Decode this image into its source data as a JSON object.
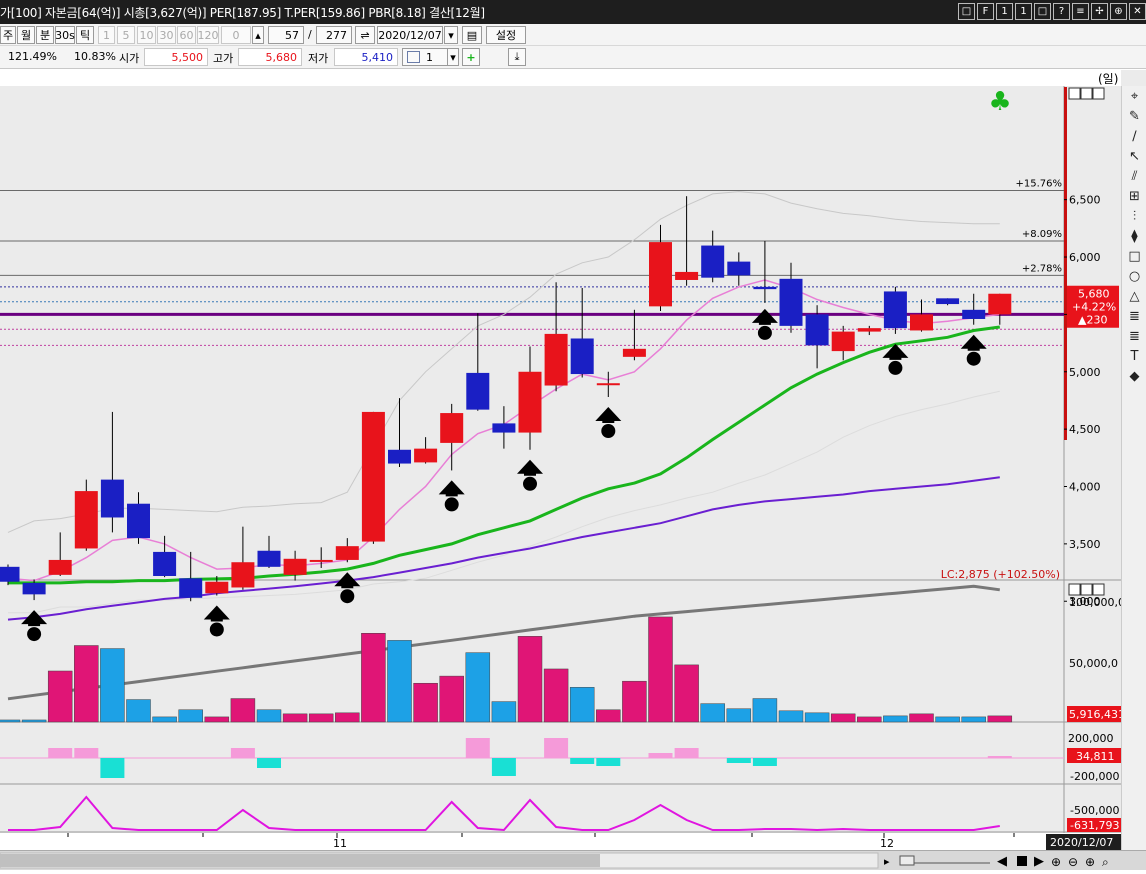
{
  "title": "가[100] 자본금[64(억)] 시총[3,627(억)] PER[187.95] T.PER[159.86] PBR[8.18] 결산[12월]",
  "window_buttons": [
    "□",
    "F",
    "1",
    "1",
    "□",
    "?",
    "≡",
    "✢",
    "⊕",
    "✕"
  ],
  "toolbar": {
    "period_buttons": [
      "주",
      "월",
      "분",
      "30s",
      "틱"
    ],
    "interval_buttons": [
      "1",
      "5",
      "10",
      "30",
      "60",
      "120"
    ],
    "interval_value": "0",
    "count_value": "57",
    "separator": "/",
    "total_value": "277",
    "date_value": "2020/12/07",
    "settings_label": "설정"
  },
  "quote": {
    "rate": "121.49%",
    "change_pct": "10.83%",
    "open_label": "시가",
    "open_value": "5,500",
    "high_label": "고가",
    "high_value": "5,680",
    "low_label": "저가",
    "low_value": "5,410",
    "spin_value": "1"
  },
  "chart_data": {
    "type": "candlestick",
    "unit_label": "(일)",
    "x_ticks": [
      "11",
      "12"
    ],
    "current_date": "2020/12/07",
    "price_ticks": [
      "6,500",
      "6,000",
      "5,500",
      "5,000",
      "4,500",
      "4,000",
      "3,500",
      "3,000"
    ],
    "candles": [
      {
        "o": 3300,
        "c": 3170,
        "h": 3320,
        "l": 3140
      },
      {
        "o": 3160,
        "c": 3060,
        "h": 3190,
        "l": 3010
      },
      {
        "o": 3230,
        "c": 3360,
        "h": 3600,
        "l": 3220
      },
      {
        "o": 3460,
        "c": 3960,
        "h": 4060,
        "l": 3440
      },
      {
        "o": 4060,
        "c": 3730,
        "h": 4650,
        "l": 3600
      },
      {
        "o": 3850,
        "c": 3550,
        "h": 3950,
        "l": 3500
      },
      {
        "o": 3430,
        "c": 3220,
        "h": 3570,
        "l": 3210
      },
      {
        "o": 3200,
        "c": 3030,
        "h": 3430,
        "l": 3000
      },
      {
        "o": 3070,
        "c": 3170,
        "h": 3220,
        "l": 3050
      },
      {
        "o": 3120,
        "c": 3340,
        "h": 3650,
        "l": 3100
      },
      {
        "o": 3440,
        "c": 3300,
        "h": 3570,
        "l": 3290
      },
      {
        "o": 3230,
        "c": 3370,
        "h": 3440,
        "l": 3180
      },
      {
        "o": 3360,
        "c": 3360,
        "h": 3470,
        "l": 3290
      },
      {
        "o": 3360,
        "c": 3480,
        "h": 3550,
        "l": 3340
      },
      {
        "o": 3520,
        "c": 4650,
        "h": 4650,
        "l": 3500
      },
      {
        "o": 4320,
        "c": 4200,
        "h": 4770,
        "l": 4170
      },
      {
        "o": 4210,
        "c": 4330,
        "h": 4430,
        "l": 4200
      },
      {
        "o": 4380,
        "c": 4640,
        "h": 4720,
        "l": 4140
      },
      {
        "o": 4990,
        "c": 4670,
        "h": 5510,
        "l": 4660
      },
      {
        "o": 4550,
        "c": 4470,
        "h": 4700,
        "l": 4330
      },
      {
        "o": 4470,
        "c": 5000,
        "h": 5220,
        "l": 4320
      },
      {
        "o": 4880,
        "c": 5330,
        "h": 5780,
        "l": 4830
      },
      {
        "o": 5290,
        "c": 4980,
        "h": 5730,
        "l": 4950
      },
      {
        "o": 4900,
        "c": 4900,
        "h": 5000,
        "l": 4780
      },
      {
        "o": 5130,
        "c": 5200,
        "h": 5540,
        "l": 5100
      },
      {
        "o": 5570,
        "c": 6130,
        "h": 6280,
        "l": 5530
      },
      {
        "o": 5800,
        "c": 5870,
        "h": 6530,
        "l": 5750
      },
      {
        "o": 6100,
        "c": 5820,
        "h": 6230,
        "l": 5780
      },
      {
        "o": 5960,
        "c": 5840,
        "h": 6040,
        "l": 5750
      },
      {
        "o": 5740,
        "c": 5720,
        "h": 6140,
        "l": 5600
      },
      {
        "o": 5810,
        "c": 5400,
        "h": 5950,
        "l": 5340
      },
      {
        "o": 5500,
        "c": 5230,
        "h": 5580,
        "l": 5030
      },
      {
        "o": 5180,
        "c": 5350,
        "h": 5400,
        "l": 5100
      },
      {
        "o": 5350,
        "c": 5380,
        "h": 5400,
        "l": 5320
      },
      {
        "o": 5700,
        "c": 5380,
        "h": 5740,
        "l": 5330
      },
      {
        "o": 5360,
        "c": 5500,
        "h": 5630,
        "l": 5350
      },
      {
        "o": 5640,
        "c": 5590,
        "h": 5640,
        "l": 5580
      },
      {
        "o": 5540,
        "c": 5460,
        "h": 5680,
        "l": 5410
      },
      {
        "o": 5500,
        "c": 5680,
        "h": 5680,
        "l": 5410
      }
    ],
    "ma_short": [
      3200,
      3180,
      3260,
      3380,
      3530,
      3560,
      3500,
      3380,
      3280,
      3290,
      3320,
      3310,
      3330,
      3360,
      3560,
      3800,
      4000,
      4280,
      4460,
      4540,
      4700,
      4850,
      4980,
      4930,
      5000,
      5200,
      5450,
      5640,
      5740,
      5800,
      5730,
      5630,
      5560,
      5500,
      5450,
      5420,
      5440,
      5470,
      5500
    ],
    "ma_green": [
      3160,
      3160,
      3160,
      3170,
      3170,
      3180,
      3180,
      3190,
      3195,
      3200,
      3220,
      3235,
      3255,
      3280,
      3330,
      3400,
      3450,
      3500,
      3580,
      3640,
      3700,
      3800,
      3900,
      3980,
      4030,
      4110,
      4250,
      4410,
      4560,
      4710,
      4860,
      4980,
      5080,
      5170,
      5240,
      5270,
      5300,
      5360,
      5390
    ],
    "ma_purple": [
      2840,
      2860,
      2890,
      2930,
      2960,
      2990,
      3020,
      3040,
      3070,
      3090,
      3110,
      3130,
      3155,
      3180,
      3210,
      3250,
      3290,
      3330,
      3380,
      3420,
      3460,
      3510,
      3560,
      3600,
      3640,
      3680,
      3740,
      3800,
      3840,
      3870,
      3890,
      3910,
      3930,
      3960,
      3980,
      4000,
      4020,
      4050,
      4080
    ],
    "ma_gray": [
      2150,
      2180,
      2210,
      2240,
      2270,
      2300,
      2330,
      2360,
      2390,
      2420,
      2450,
      2480,
      2510,
      2540,
      2570,
      2600,
      2630,
      2660,
      2690,
      2720,
      2750,
      2780,
      2810,
      2840,
      2870,
      2890,
      2910,
      2930,
      2950,
      2970,
      2990,
      3010,
      3030,
      3050,
      3070,
      3090,
      3110,
      3130,
      3100
    ],
    "signal_up_indices": [
      1,
      8,
      13,
      17,
      20,
      23,
      34,
      37
    ],
    "signal_down_indices": [
      29
    ],
    "hlines": [
      {
        "label": "+15.76%",
        "value": 6580
      },
      {
        "label": "+8.09%",
        "value": 6140
      },
      {
        "label": "+2.78%",
        "value": 5840
      }
    ],
    "current": {
      "price": "5,680",
      "change_pct": "+4.22%",
      "change": "▲230"
    },
    "purple_line_value": 5500,
    "lc_label": "LC:2,875 (+102.50%)",
    "volume": [
      2,
      2,
      50,
      75,
      72,
      22,
      5,
      12,
      5,
      23,
      12,
      8,
      8,
      9,
      87,
      80,
      38,
      45,
      68,
      20,
      84,
      52,
      34,
      12,
      40,
      103,
      56,
      18,
      13,
      23,
      11,
      9,
      8,
      5,
      6,
      8,
      5,
      5,
      6
    ],
    "volume_ticks": [
      "100,000,0",
      "50,000,0"
    ],
    "volume_value": "5,916,431",
    "osc": [
      0,
      0,
      10,
      10,
      -20,
      0,
      0,
      0,
      0,
      10,
      -10,
      0,
      0,
      0,
      0,
      0,
      0,
      0,
      20,
      -18,
      0,
      20,
      -6,
      -8,
      0,
      5,
      10,
      0,
      -5,
      -8,
      0,
      0,
      0,
      0,
      0,
      0,
      0,
      0,
      2
    ],
    "osc_ticks": [
      "200,000",
      "-200,000"
    ],
    "osc_value": "34,811",
    "line3": [
      0,
      0,
      3,
      33,
      2,
      0,
      0,
      0,
      0,
      20,
      2,
      0,
      0,
      0,
      0,
      0,
      0,
      28,
      2,
      0,
      30,
      3,
      0,
      0,
      10,
      25,
      10,
      0,
      0,
      1,
      1,
      0,
      1,
      0,
      0,
      0,
      0,
      0,
      4
    ],
    "line3_ticks": [
      "-500,000"
    ],
    "line3_value": "-631,793"
  },
  "colors": {
    "up": "#e8131b",
    "down": "#1a1fc4",
    "ma_short": "#e87fd6",
    "ma_green": "#19b51c",
    "ma_purple": "#6a1fd1",
    "ma_gray": "#777777",
    "vol_up": "#e01576",
    "vol_down": "#1da1e6",
    "osc_pos": "#f59ad9",
    "osc_neg": "#19e0d4",
    "line3": "#e015e0",
    "club": "#19b51c"
  },
  "right_tools": [
    "(일)",
    "⌖",
    "✎",
    "∕",
    "↖",
    "⫽",
    "⊞",
    "⫶",
    "⧫",
    "□",
    "○",
    "△",
    "≣",
    "≣",
    "T",
    "◆"
  ],
  "club_icon": "♣"
}
